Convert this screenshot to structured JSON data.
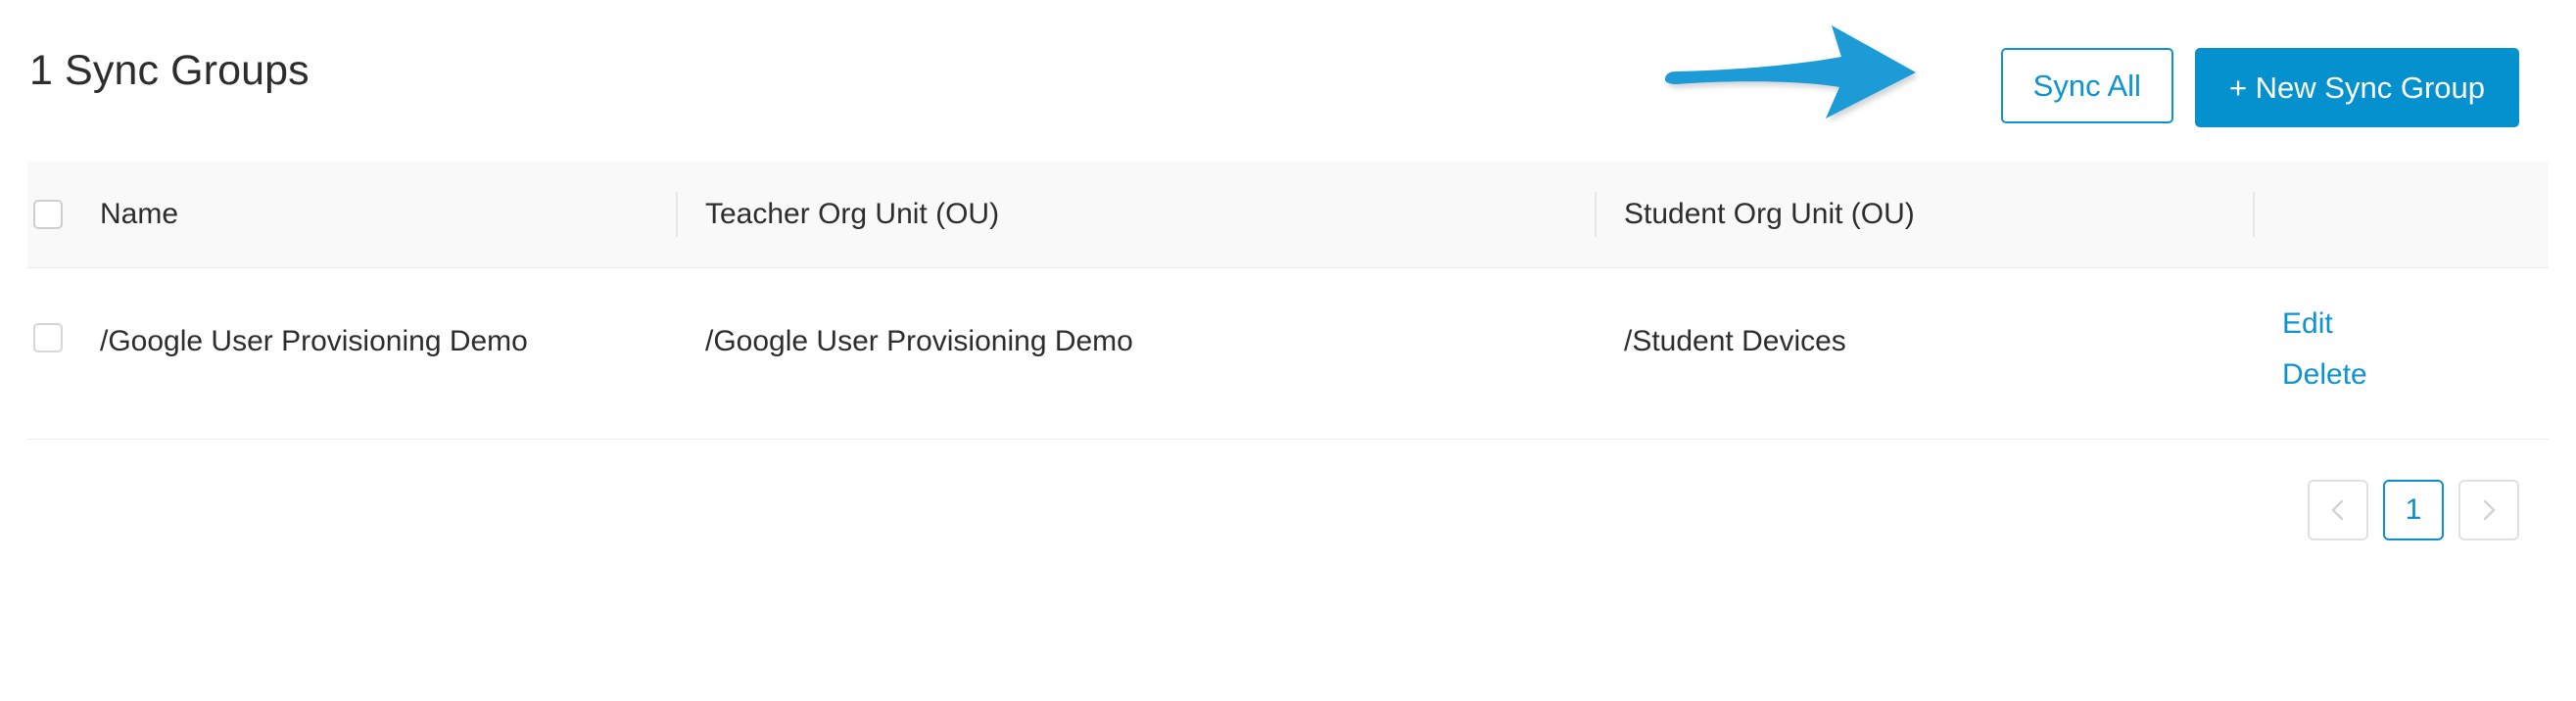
{
  "header": {
    "title": "1 Sync Groups",
    "sync_all_label": "Sync All",
    "new_sync_group_label": "+ New Sync Group"
  },
  "annotation": {
    "arrow_icon": "arrow-right-icon",
    "arrow_color": "#1a9bd7"
  },
  "table": {
    "columns": [
      {
        "key": "select",
        "label": ""
      },
      {
        "key": "name",
        "label": "Name"
      },
      {
        "key": "teacher",
        "label": "Teacher Org Unit (OU)"
      },
      {
        "key": "student",
        "label": "Student Org Unit (OU)"
      },
      {
        "key": "actions",
        "label": ""
      }
    ],
    "rows": [
      {
        "selected": false,
        "name": "/Google User Provisioning Demo",
        "teacher_ou": "/Google User Provisioning Demo",
        "student_ou": "/Student Devices",
        "actions": {
          "edit_label": "Edit",
          "delete_label": "Delete"
        }
      }
    ]
  },
  "pagination": {
    "prev_label": "‹",
    "next_label": "›",
    "pages": [
      "1"
    ],
    "current_page": "1"
  },
  "colors": {
    "accent": "#0d93d1",
    "primary_button": "#0591ce",
    "link": "#0d93d1",
    "header_band": "#f9f9f9",
    "border": "#ececec",
    "text": "#2d2d2d",
    "disabled": "#d0d0d0"
  }
}
